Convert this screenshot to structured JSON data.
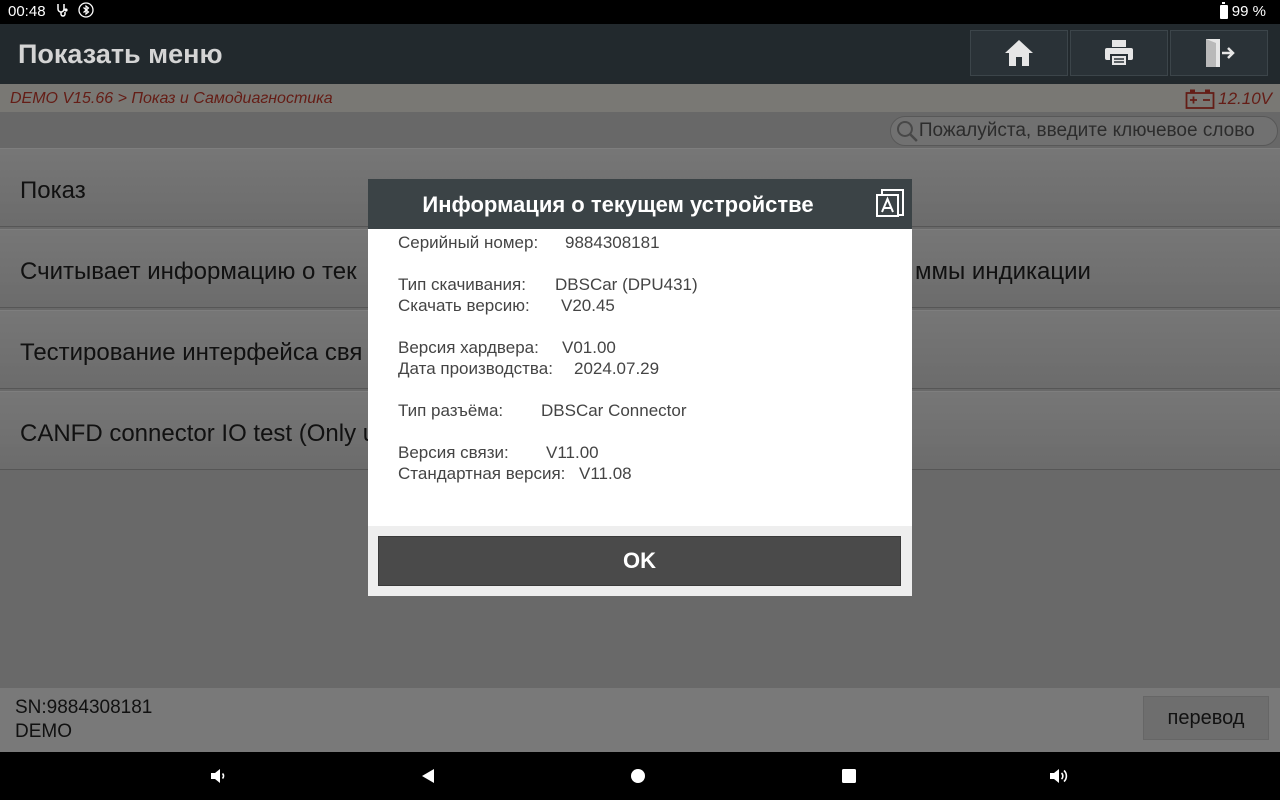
{
  "status": {
    "time": "00:48",
    "battery": "99 %"
  },
  "header": {
    "title": "Показать меню",
    "icons": [
      "home-icon",
      "print-icon",
      "exit-icon"
    ]
  },
  "breadcrumb": {
    "path": "DEMO V15.66 > Показ и Самодиагностика",
    "voltage": "12.10V"
  },
  "search": {
    "placeholder": "Пожалуйста, введите ключевое слово"
  },
  "menu": {
    "items": [
      {
        "label": "Показ",
        "label_right": ""
      },
      {
        "label": "Считывает информацию о текущем устройстве и версии программы индикации",
        "label_left_visible": "Считывает информацию о тек",
        "label_right": "ммы индикации"
      },
      {
        "label": "Тестирование интерфейса свя",
        "label_right": ""
      },
      {
        "label": "CANFD connector IO test (Only u",
        "label_right": ""
      }
    ]
  },
  "footer": {
    "sn": "SN:9884308181",
    "mode": "DEMO",
    "translate_label": "перевод"
  },
  "dialog": {
    "title": "Информация о текущем устройстве",
    "rows": [
      {
        "key": "Серийный номер:",
        "value": "9884308181"
      },
      {
        "key": "Тип скачивания:",
        "value": "DBSCar (DPU431)"
      },
      {
        "key": "Скачать версию:",
        "value": "V20.45"
      },
      {
        "key": "Версия хардвера:",
        "value": "V01.00"
      },
      {
        "key": "Дата производства:",
        "value": "2024.07.29"
      },
      {
        "key": "Тип разъёма:",
        "value": "DBSCar Connector"
      },
      {
        "key": "Версия связи:",
        "value": "V11.00"
      },
      {
        "key": "Стандартная версия:",
        "value": "V11.08"
      }
    ],
    "ok_label": "OK"
  },
  "colors": {
    "appbar": "#22292d",
    "breadcrumb_text": "#c0392b",
    "dialog_header": "#3b4346",
    "ok_button": "#4a4a4a"
  }
}
